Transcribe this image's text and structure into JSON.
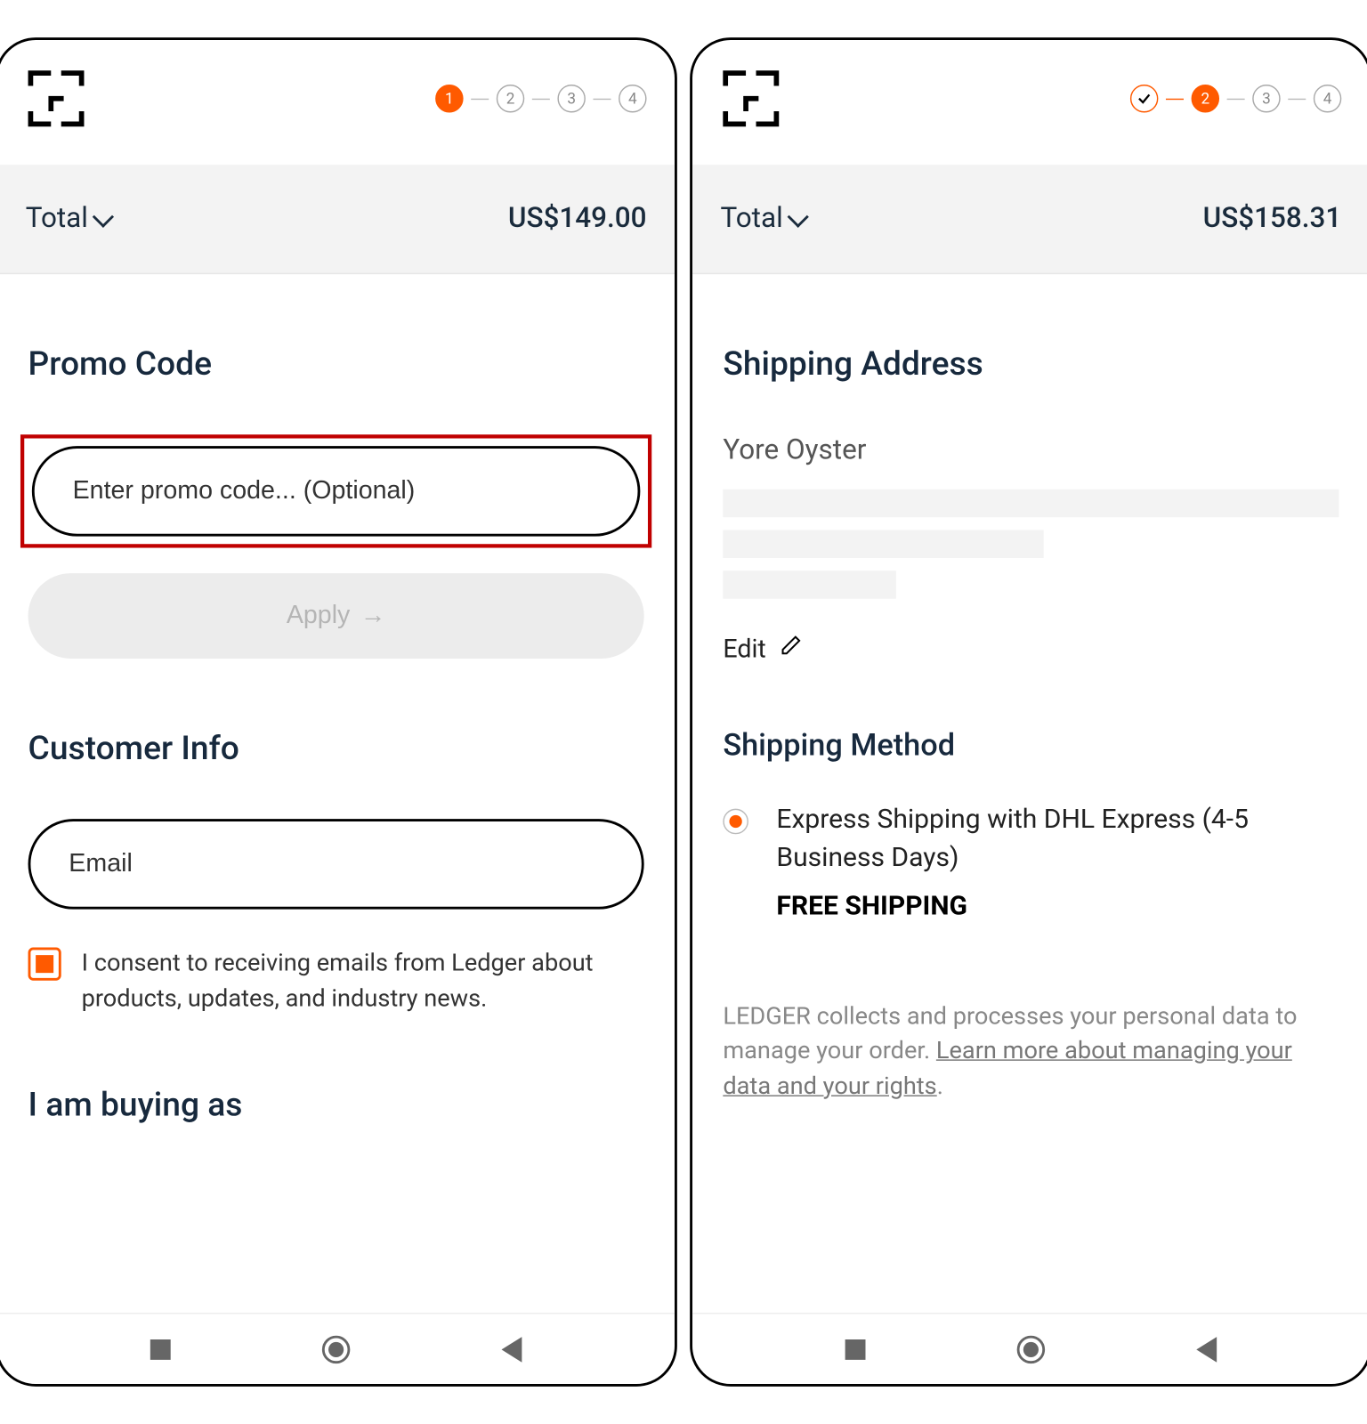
{
  "left": {
    "stepper": {
      "active": 1,
      "steps": [
        "1",
        "2",
        "3",
        "4"
      ]
    },
    "total_label": "Total",
    "total_amount": "US$149.00",
    "promo_title": "Promo Code",
    "promo_placeholder": "Enter promo code... (Optional)",
    "apply_label": "Apply",
    "customer_title": "Customer Info",
    "email_placeholder": "Email",
    "consent_text": "I consent to receiving emails from Ledger about products, updates, and industry news.",
    "buying_title": "I am buying as"
  },
  "right": {
    "stepper": {
      "done": 1,
      "active": 2,
      "steps": [
        "✓",
        "2",
        "3",
        "4"
      ]
    },
    "total_label": "Total",
    "total_amount": "US$158.31",
    "addr_title": "Shipping Address",
    "name": "Yore Oyster",
    "edit_label": "Edit",
    "method_title": "Shipping Method",
    "ship_option": "Express Shipping with DHL Express (4-5 Business Days)",
    "free_label": "FREE SHIPPING",
    "legal_prefix": "LEDGER collects and processes your personal data to manage your order. ",
    "legal_link": "Learn more about managing your data and your rights",
    "legal_suffix": "."
  }
}
